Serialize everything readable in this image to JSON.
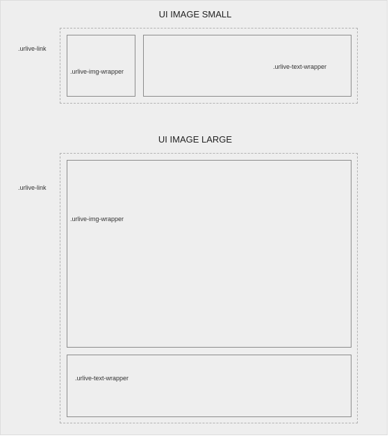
{
  "small": {
    "title": "UI IMAGE SMALL",
    "link_label": ".urlive-link",
    "img_wrapper_label": ".urlive-img-wrapper",
    "text_wrapper_label": ".urlive-text-wrapper"
  },
  "large": {
    "title": "UI IMAGE LARGE",
    "link_label": ".urlive-link",
    "img_wrapper_label": ".urlive-img-wrapper",
    "text_wrapper_label": ".urlive-text-wrapper"
  },
  "colors": {
    "background": "#eeeeee",
    "dashed_border": "#b0b0b0",
    "solid_border": "#8a8a8a",
    "text": "#333333"
  }
}
